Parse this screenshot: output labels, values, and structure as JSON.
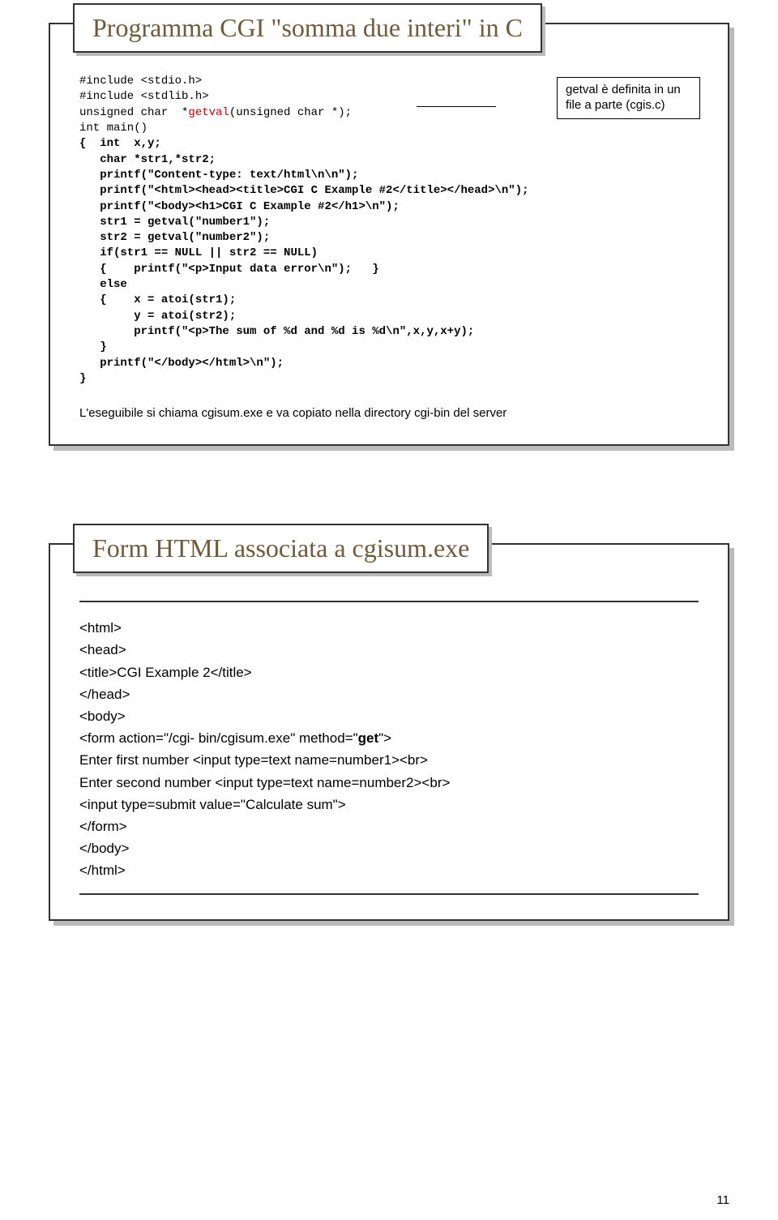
{
  "slide1": {
    "title": "Programma CGI \"somma due interi\" in C",
    "note": "getval è definita in un file a parte (cgis.c)",
    "code_lines": [
      "#include <stdio.h>",
      "#include <stdlib.h>",
      "unsigned char  *getval(unsigned char *);",
      "int main()",
      "{  int  x,y;",
      "   char *str1,*str2;",
      "   printf(\"Content-type: text/html\\n\\n\");",
      "   printf(\"<html><head><title>CGI C Example #2</title></head>\\n\");",
      "   printf(\"<body><h1>CGI C Example #2</h1>\\n\");",
      "   str1 = getval(\"number1\");",
      "   str2 = getval(\"number2\");",
      "   if(str1 == NULL || str2 == NULL)",
      "   {    printf(\"<p>Input data error\\n\");   }",
      "   else",
      "   {    x = atoi(str1);",
      "        y = atoi(str2);",
      "        printf(\"<p>The sum of %d and %d is %d\\n\",x,y,x+y);",
      "   }",
      "   printf(\"</body></html>\\n\");",
      "}"
    ],
    "caption": "L'eseguibile si chiama cgisum.exe e va copiato nella directory cgi-bin del server"
  },
  "slide2": {
    "title": "Form HTML associata a cgisum.exe",
    "lines": {
      "l0": "<html>",
      "l1": "<head>",
      "l2": "<title>CGI Example 2</title>",
      "l3": "</head>",
      "l4": "<body>",
      "l5a": "<form action=\"/cgi- bin/cgisum.exe\" method=\"",
      "l5b": "get",
      "l5c": "\">",
      "l6": "Enter first number <input type=text name=number1><br>",
      "l7": "Enter second number <input type=text name=number2><br>",
      "l8": "<input type=submit value=\"Calculate sum\">",
      "l9": "</form>",
      "l10": "</body>",
      "l11": "</html>"
    }
  },
  "page_number": "11"
}
